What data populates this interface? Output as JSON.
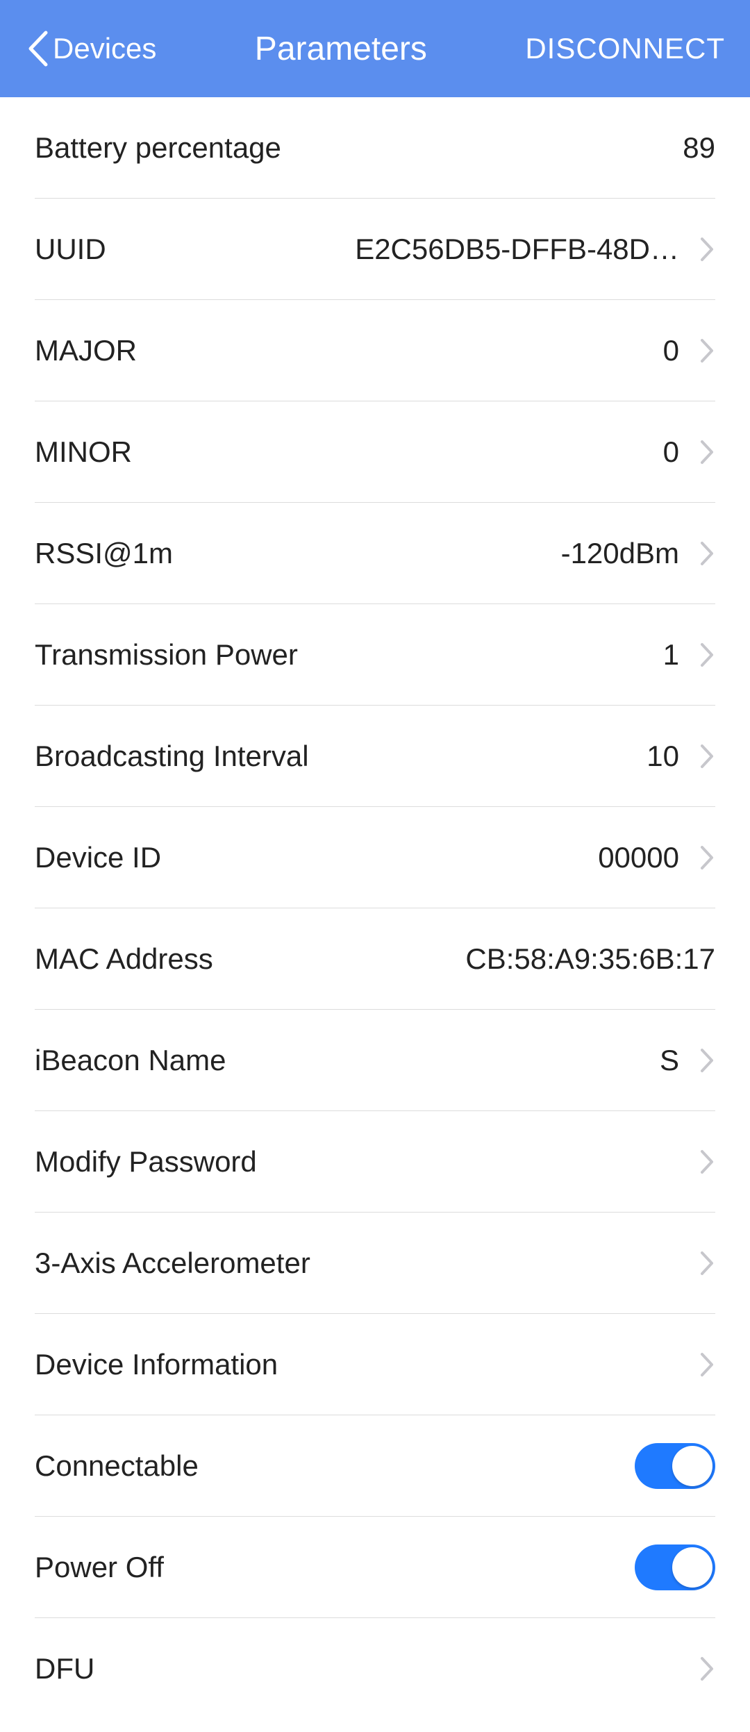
{
  "header": {
    "back_label": "Devices",
    "title": "Parameters",
    "disconnect": "DISCONNECT"
  },
  "rows": {
    "battery": {
      "label": "Battery percentage",
      "value": "89"
    },
    "uuid": {
      "label": "UUID",
      "value": "E2C56DB5-DFFB-48D…"
    },
    "major": {
      "label": "MAJOR",
      "value": "0"
    },
    "minor": {
      "label": "MINOR",
      "value": "0"
    },
    "rssi": {
      "label": "RSSI@1m",
      "value": "-120dBm"
    },
    "txpower": {
      "label": "Transmission Power",
      "value": "1"
    },
    "interval": {
      "label": "Broadcasting Interval",
      "value": "10"
    },
    "deviceid": {
      "label": "Device ID",
      "value": "00000"
    },
    "mac": {
      "label": "MAC Address",
      "value": "CB:58:A9:35:6B:17"
    },
    "ibeacon": {
      "label": "iBeacon Name",
      "value": "S"
    },
    "password": {
      "label": "Modify Password"
    },
    "accel": {
      "label": "3-Axis Accelerometer"
    },
    "devinfo": {
      "label": "Device Information"
    },
    "connectable": {
      "label": "Connectable",
      "on": true
    },
    "poweroff": {
      "label": "Power Off",
      "on": true
    },
    "dfu": {
      "label": "DFU"
    }
  }
}
